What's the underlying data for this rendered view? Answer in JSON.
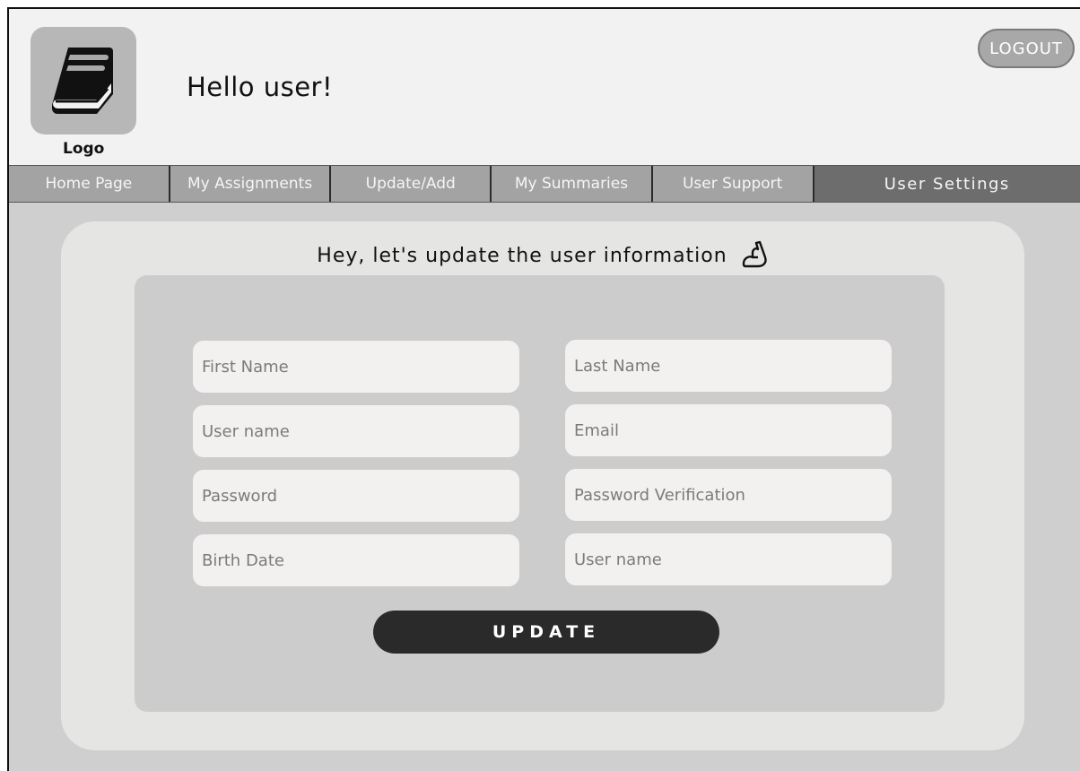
{
  "header": {
    "logo_label": "Logo",
    "greeting": "Hello user!",
    "logout_label": "LOGOUT"
  },
  "nav": {
    "items": [
      {
        "label": "Home Page"
      },
      {
        "label": "My Assignments"
      },
      {
        "label": "Update/Add"
      },
      {
        "label": "My Summaries"
      },
      {
        "label": "User Support"
      },
      {
        "label": "User Settings",
        "active": true
      }
    ]
  },
  "form": {
    "title": "Hey, let's update the user information",
    "fields": {
      "first_name": "First Name",
      "last_name": "Last Name",
      "user_name": "User name",
      "email": "Email",
      "password": "Password",
      "password_verification": "Password Verification",
      "birth_date": "Birth Date",
      "user_name_2": "User name"
    },
    "submit_label": "UPDATE"
  },
  "icons": {
    "logo": "book-icon",
    "title": "waving-hand-icon"
  },
  "colors": {
    "background": "#cfcfcf",
    "header": "#f3f2f2",
    "nav": "#a3a3a3",
    "nav_active": "#6d6d6d",
    "outer_panel": "#e5e5e4",
    "inner_panel": "#cccccc",
    "field": "#f3f0f0",
    "button": "#2a2a2a"
  }
}
